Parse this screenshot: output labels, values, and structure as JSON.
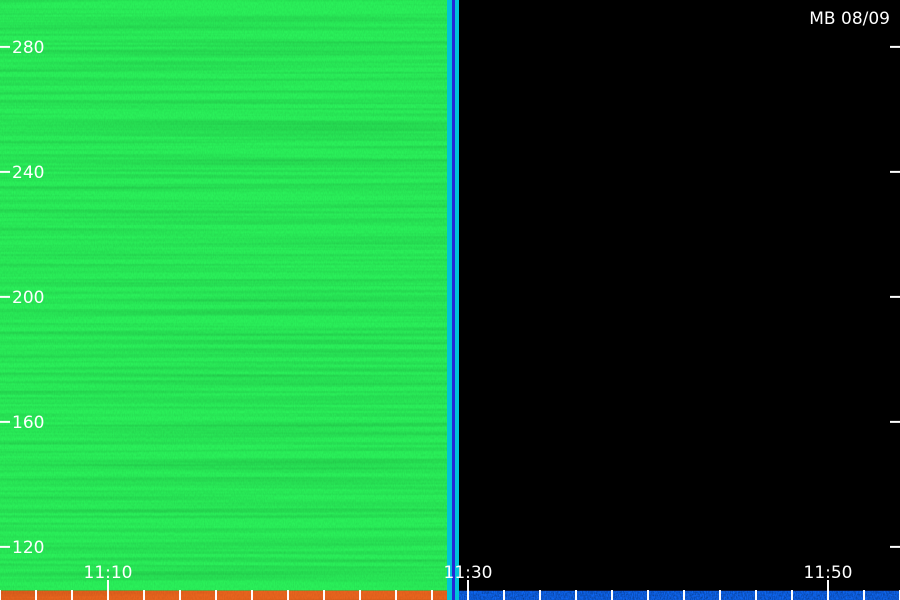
{
  "chart_data": {
    "type": "heatmap",
    "title": "MB 08/09",
    "xlabel": "",
    "ylabel": "",
    "x_axis": {
      "range": [
        "11:04",
        "11:54"
      ],
      "labeled_ticks": [
        "11:10",
        "11:30",
        "11:50"
      ],
      "minor_tick_step_minutes": 2
    },
    "y_axis": {
      "range": [
        103,
        295
      ],
      "labeled_ticks": [
        120,
        160,
        200,
        240,
        280
      ],
      "minor_tick_step": 20
    },
    "grid": false,
    "legend": "none",
    "regions": [
      {
        "name": "",
        "x_range": [
          "11:04",
          "11:29"
        ],
        "y_range": [
          106,
          295
        ],
        "level": 0.55
      },
      {
        "name": "",
        "x_range": [
          "11:04",
          "11:29"
        ],
        "y_range": [
          103,
          106
        ],
        "level": 0.9
      },
      {
        "name": "",
        "x_range": [
          "11:29",
          "11:54"
        ],
        "y_range": [
          103,
          106
        ],
        "level": 0.3
      },
      {
        "name": "",
        "x_range": [
          "11:29",
          "11:54"
        ],
        "y_range": [
          106,
          295
        ],
        "level": 0.05
      }
    ],
    "markers": [
      {
        "x": "11:29",
        "style": "vertical band"
      }
    ],
    "colors": {
      "background": "#000000",
      "high": "#e8641e",
      "mid_high": "#2af05a",
      "mid": "#00c8ff",
      "low": "#2a18d0",
      "faint": "#3a1080",
      "text": "#ffffff"
    }
  }
}
